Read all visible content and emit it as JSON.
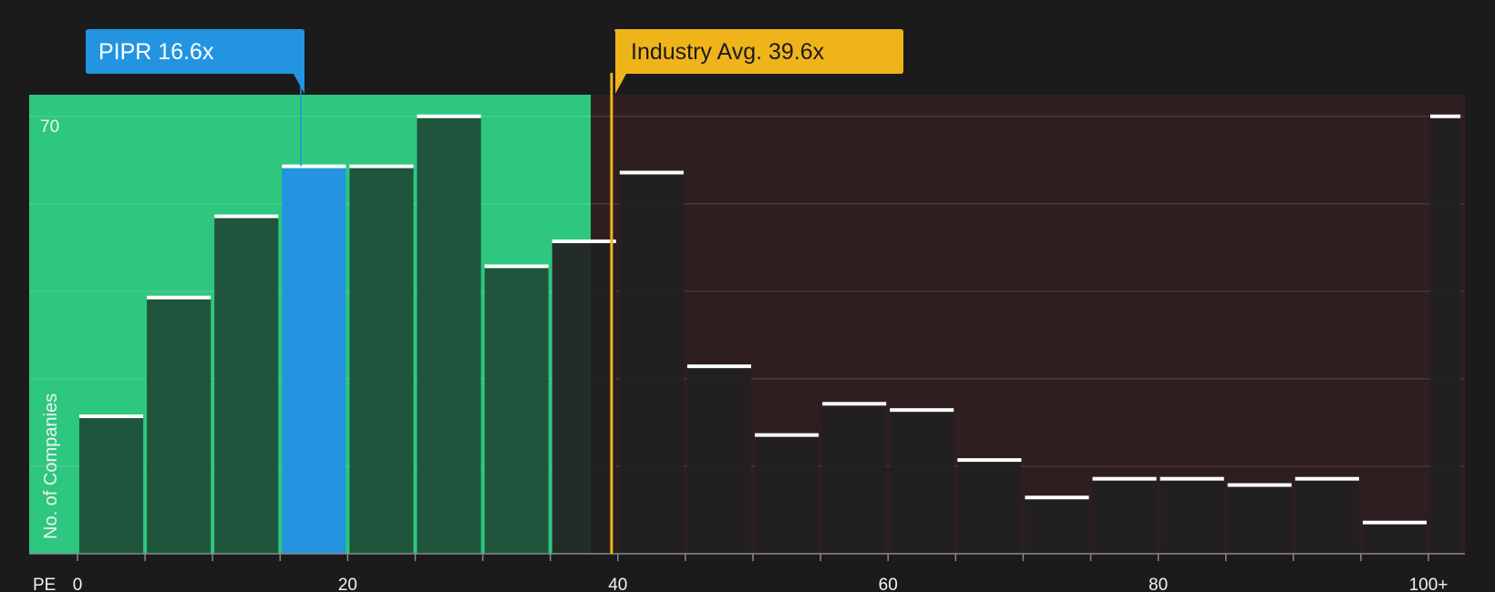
{
  "chart_data": {
    "type": "bar",
    "xlabel": "PE",
    "ylabel": "No. of Companies",
    "ylim": [
      0,
      72
    ],
    "ytick_shown": "70",
    "x_tick_labels": [
      "0",
      "20",
      "40",
      "60",
      "80",
      "100+"
    ],
    "bins": [
      {
        "x0": 0,
        "x1": 5,
        "value": 22
      },
      {
        "x0": 5,
        "x1": 10,
        "value": 41
      },
      {
        "x0": 10,
        "x1": 15,
        "value": 54
      },
      {
        "x0": 15,
        "x1": 20,
        "value": 62,
        "highlight": true
      },
      {
        "x0": 20,
        "x1": 25,
        "value": 62
      },
      {
        "x0": 25,
        "x1": 30,
        "value": 70
      },
      {
        "x0": 30,
        "x1": 35,
        "value": 46
      },
      {
        "x0": 35,
        "x1": 40,
        "value": 50
      },
      {
        "x0": 40,
        "x1": 45,
        "value": 61
      },
      {
        "x0": 45,
        "x1": 50,
        "value": 30
      },
      {
        "x0": 50,
        "x1": 55,
        "value": 19
      },
      {
        "x0": 55,
        "x1": 60,
        "value": 24
      },
      {
        "x0": 60,
        "x1": 65,
        "value": 23
      },
      {
        "x0": 65,
        "x1": 70,
        "value": 15
      },
      {
        "x0": 70,
        "x1": 75,
        "value": 9
      },
      {
        "x0": 75,
        "x1": 80,
        "value": 12
      },
      {
        "x0": 80,
        "x1": 85,
        "value": 12
      },
      {
        "x0": 85,
        "x1": 90,
        "value": 11
      },
      {
        "x0": 90,
        "x1": 95,
        "value": 12
      },
      {
        "x0": 95,
        "x1": 100,
        "value": 5
      },
      {
        "x0": 100,
        "x1": 102.5,
        "value": 70
      }
    ],
    "subject": {
      "label": "PIPR 16.6x",
      "value": 16.6
    },
    "industry": {
      "label": "Industry Avg. 39.6x",
      "value": 39.6
    },
    "fair_region_end": 38,
    "colors": {
      "background": "#1b1b1c",
      "fair_region": "#2ec77f",
      "over_region": "#2e1e1f",
      "bar_fair": "#1e4a37",
      "bar_over": "#222021",
      "highlight": "#2394e0",
      "industry": "#f0b41b",
      "cap": "#ffffff",
      "grid": "#ffffff"
    }
  }
}
